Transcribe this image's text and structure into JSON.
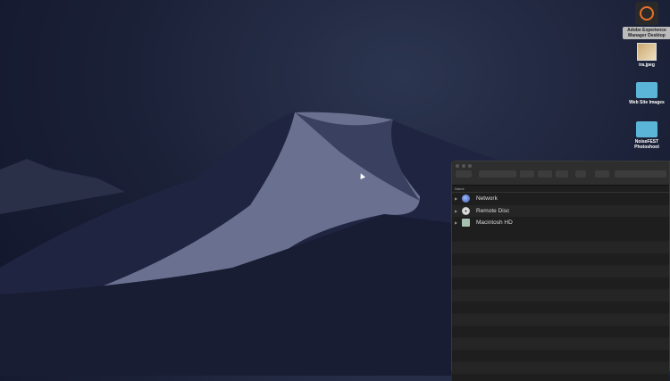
{
  "desktop": {
    "icons": [
      {
        "label": "Adobe Experience Manager Desktop",
        "icon": "aem-app-icon"
      },
      {
        "label": "ira.jpeg",
        "icon": "image-thumbnail-icon"
      },
      {
        "label": "Web Site Images",
        "icon": "folder-icon"
      },
      {
        "label": "NoiseFEST Photoshoot",
        "icon": "folder-icon"
      }
    ]
  },
  "finder": {
    "column_header": "Name",
    "items": [
      {
        "label": "Network",
        "icon": "network-globe-icon"
      },
      {
        "label": "Remote Disc",
        "icon": "disc-icon"
      },
      {
        "label": "Macintosh HD",
        "icon": "hard-drive-icon"
      }
    ]
  }
}
